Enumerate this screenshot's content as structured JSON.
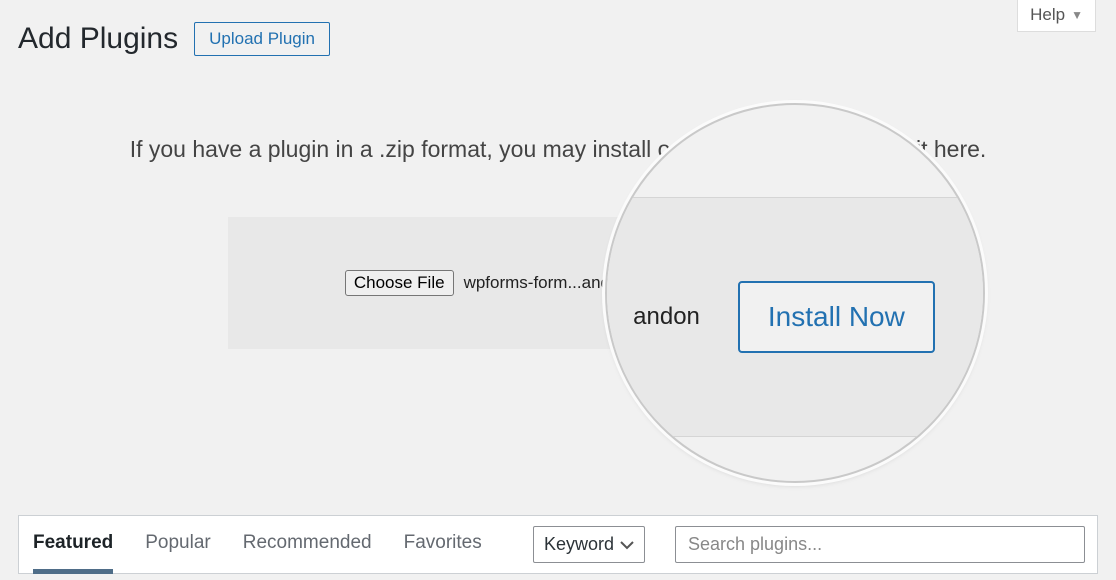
{
  "help": {
    "label": "Help"
  },
  "header": {
    "title": "Add Plugins",
    "upload_button": "Upload Plugin"
  },
  "upload": {
    "description": "If you have a plugin in a .zip format, you may install or update it by uploading it here.",
    "choose_file_label": "Choose File",
    "filename": "wpforms-form...andon",
    "install_label": "Install Now",
    "zoom_filename_tail": "andon"
  },
  "filters": {
    "tabs": [
      "Featured",
      "Popular",
      "Recommended",
      "Favorites"
    ],
    "active_index": 0,
    "keyword_label": "Keyword",
    "search_placeholder": "Search plugins..."
  }
}
